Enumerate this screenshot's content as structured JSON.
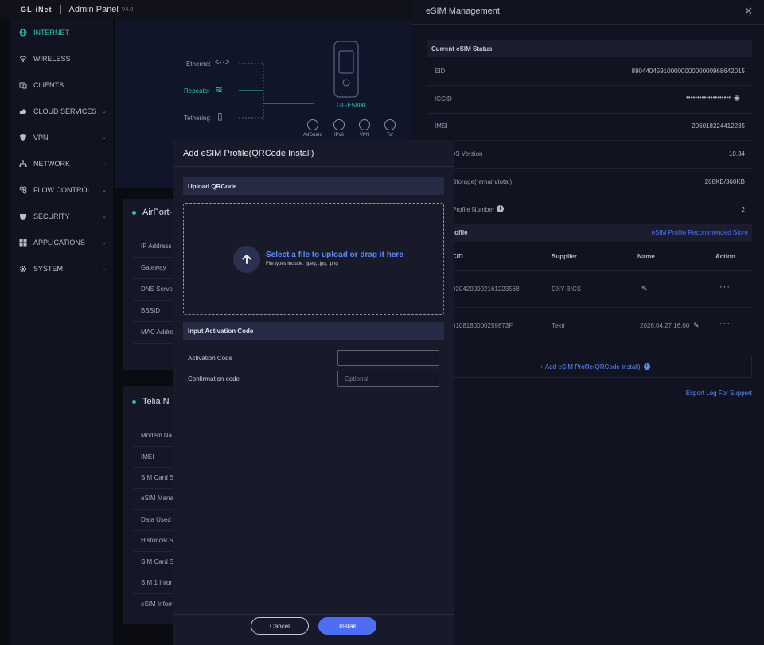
{
  "header": {
    "logo": "GL·iNet",
    "title": "Admin Panel",
    "version": "V4.0"
  },
  "sidebar": {
    "items": [
      {
        "label": "INTERNET",
        "icon": "globe-icon",
        "active": true,
        "chevron": false
      },
      {
        "label": "WIRELESS",
        "icon": "wifi-icon",
        "active": false,
        "chevron": false
      },
      {
        "label": "CLIENTS",
        "icon": "clients-icon",
        "active": false,
        "chevron": false
      },
      {
        "label": "CLOUD SERVICES",
        "icon": "cloud-icon",
        "active": false,
        "chevron": true
      },
      {
        "label": "VPN",
        "icon": "shield-icon",
        "active": false,
        "chevron": true
      },
      {
        "label": "NETWORK",
        "icon": "network-icon",
        "active": false,
        "chevron": true
      },
      {
        "label": "FLOW CONTROL",
        "icon": "flow-icon",
        "active": false,
        "chevron": true
      },
      {
        "label": "SECURITY",
        "icon": "security-icon",
        "active": false,
        "chevron": true
      },
      {
        "label": "APPLICATIONS",
        "icon": "apps-icon",
        "active": false,
        "chevron": true
      },
      {
        "label": "SYSTEM",
        "icon": "gear-icon",
        "active": false,
        "chevron": true
      }
    ]
  },
  "topology": {
    "ethernet": "Ethernet",
    "repeater": "Repeater",
    "tethering": "Tethering",
    "device": "GL-E5800",
    "features": [
      "AdGuard",
      "IPv6",
      "VPN",
      "Tor"
    ]
  },
  "cards": {
    "airport": {
      "title": "AirPort-",
      "rows": [
        "IP Address",
        "Gateway",
        "DNS Serve",
        "BSSID",
        "MAC Addre"
      ]
    },
    "telia": {
      "title": "Telia N",
      "rows": [
        "Modem Na",
        "IMEI",
        "SIM Card S",
        "eSIM Mana",
        "Data Used",
        "Historical S",
        "SIM Card S",
        "SIM 1 Infor",
        "eSIM Inforr"
      ]
    }
  },
  "modal": {
    "title": "Add eSIM Profile(QRCode Install)",
    "upload_section": "Upload QRCode",
    "upload_title": "Select a file to upload or drag it here",
    "upload_hint": "File types include: .jpeg, .jpg, .png",
    "activation_section": "Input Activation Code",
    "activation_label": "Activation Code",
    "activation_value": "",
    "confirmation_label": "Confirmation code",
    "confirmation_placeholder": "Optional",
    "cancel": "Cancel",
    "install": "Install"
  },
  "panel": {
    "title": "eSIM Management",
    "status_title": "Current eSIM Status",
    "eid_label": "EID",
    "eid_value": "89044045910000000000000968642015",
    "iccid_label": "ICCID",
    "iccid_value": "••••••••••••••••••••",
    "imsi_label": "IMSI",
    "imsi_value": "206018224412235",
    "os_label": "OS Version",
    "os_value": "10.34",
    "storage_label": "Storage(remain/total)",
    "storage_value": "268KB/360KB",
    "profile_number_label": "Profile Number",
    "profile_number_value": "2",
    "profile_section": "rofile",
    "store_link": "eSIM Profile Recommended Store",
    "columns": [
      "CID",
      "Supplier",
      "Name",
      "Action"
    ],
    "rows": [
      {
        "iccid": "9204200002161223568",
        "supplier": "DXY-BICS",
        "name": ""
      },
      {
        "iccid": "3108180000259873F",
        "supplier": "Textr",
        "name": "2026.04.27 16:00"
      }
    ],
    "add_profile": "+ Add eSIM Profile(QRCode Install)",
    "export_log": "Export Log For Support"
  }
}
